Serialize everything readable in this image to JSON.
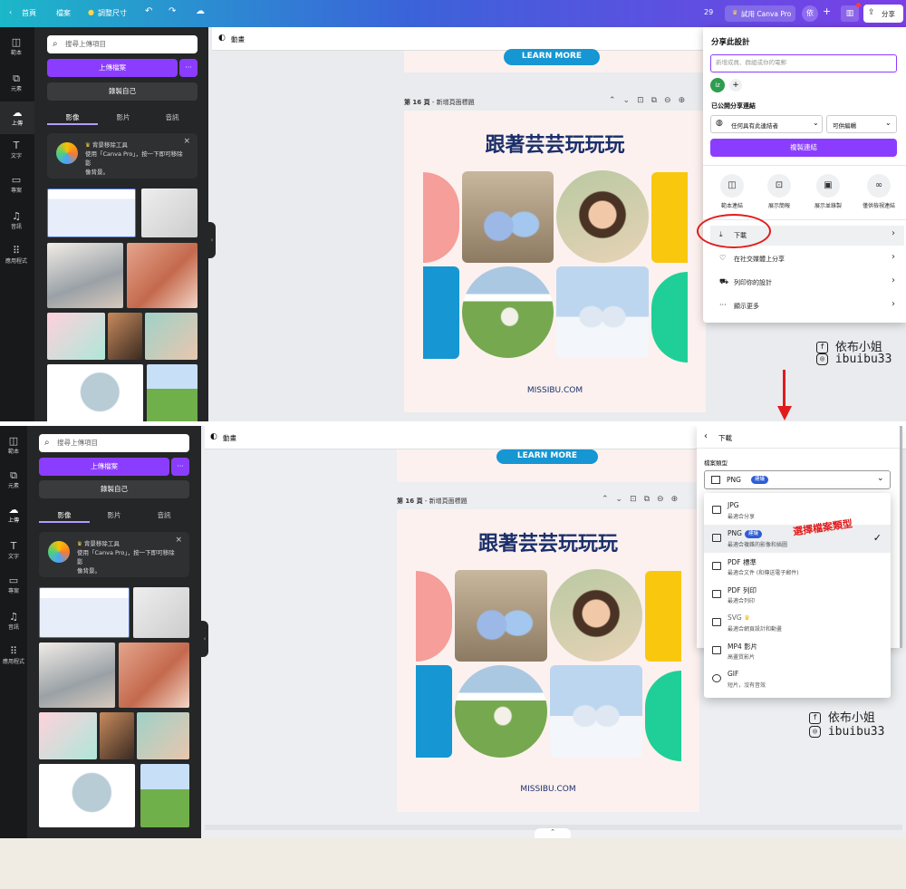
{
  "topbar": {
    "back": "首頁",
    "file": "檔案",
    "resize": "調整尺寸",
    "count": "29",
    "try_pro": "試用 Canva Pro",
    "avatar": "依",
    "share": "分享"
  },
  "rail": [
    {
      "icon": "template-icon",
      "label": "範本"
    },
    {
      "icon": "elements-icon",
      "label": "元素"
    },
    {
      "icon": "upload-icon",
      "label": "上傳"
    },
    {
      "icon": "text-icon",
      "label": "文字"
    },
    {
      "icon": "folder-icon",
      "label": "專案"
    },
    {
      "icon": "music-icon",
      "label": "音訊"
    },
    {
      "icon": "apps-icon",
      "label": "應用程式"
    }
  ],
  "uploads": {
    "search_placeholder": "搜尋上傳項目",
    "upload_button": "上傳檔案",
    "record_button": "錄製自己",
    "tabs": [
      "影像",
      "影片",
      "音訊"
    ],
    "promo_title": "背景移除工具",
    "promo_text1": "使用「Canva Pro」，按一下即可移除影",
    "promo_text2": "像背景。"
  },
  "canvas": {
    "animate": "動畫",
    "page_label": "第 16 頁",
    "page_sub": "- 新增頁面標題",
    "banner": "LEARN MORE",
    "title": "跟著芸芸玩玩玩",
    "footer": "MISSIBU.COM"
  },
  "share": {
    "title": "分享此設計",
    "invite_placeholder": "新增成員、群組或你的電郵",
    "public_link": "已公開分享連結",
    "access": "任何具有此連結者",
    "permission": "可供編輯",
    "copy_link": "複製連結",
    "actions": [
      "範本連結",
      "展示簡報",
      "展示並錄製",
      "僅供檢視連結"
    ],
    "menu": [
      "下載",
      "在社交媒體上分享",
      "列印你的設計",
      "顯示更多"
    ]
  },
  "download": {
    "title": "下載",
    "file_type_label": "檔案類型",
    "selected": "PNG",
    "selected_badge": "建議",
    "options": [
      {
        "name": "JPG",
        "desc": "最適合分享"
      },
      {
        "name": "PNG",
        "badge": "建議",
        "desc": "最適合複雜的影像和插圖"
      },
      {
        "name": "PDF 標準",
        "desc": "最適合文件 (和傳送電子郵件)"
      },
      {
        "name": "PDF 列印",
        "desc": "最適合列印"
      },
      {
        "name": "SVG",
        "desc": "最適合網頁設計和動畫"
      },
      {
        "name": "MP4 影片",
        "desc": "高畫質影片"
      },
      {
        "name": "GIF",
        "desc": "短片，沒有音效"
      }
    ]
  },
  "annotation": {
    "text": "選擇檔案類型"
  },
  "watermark": {
    "facebook": "依布小姐",
    "instagram": "ibuibu33"
  },
  "colors": {
    "accent": "#8b3dff",
    "title": "#1b2f6b",
    "pink": "#f59e9a",
    "yellow": "#f9c80e",
    "blue": "#1696d2",
    "green": "#1fcf97",
    "red": "#e11b1b"
  }
}
